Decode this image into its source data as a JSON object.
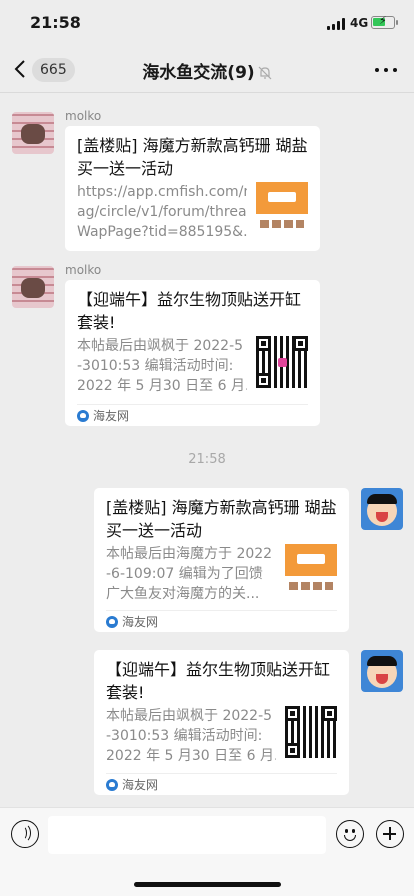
{
  "status_bar": {
    "time": "21:58",
    "network": "4G",
    "battery_level": 0.55,
    "battery_color": "#34c759"
  },
  "nav": {
    "back_icon": "chevron-left-icon",
    "unread_count": "665",
    "title": "海水鱼交流(9)",
    "mute_icon": "bell-slash-icon",
    "more_icon": "more-icon"
  },
  "messages": [
    {
      "sender": "molko",
      "title": "[盖楼贴] 海魔方新款高钙珊 瑚盐买一送一活动",
      "desc_lines": [
        "https://app.cmfish.com/m",
        "ag/circle/v1/forum/thread",
        "WapPage?tid=885195&..."
      ],
      "source": ""
    },
    {
      "sender": "molko",
      "title": "【迎端午】益尔生物顶贴送开缸套装!",
      "desc_lines": [
        "本帖最后由飒枫于 2022-5",
        "-3010:53 编辑活动时间:",
        "2022 年 5 月30 日至 6 月..."
      ],
      "source": "海友网"
    },
    {
      "sender": "",
      "title": "[盖楼贴] 海魔方新款高钙珊 瑚盐买一送一活动",
      "desc_lines": [
        "本帖最后由海魔方于 2022",
        "-6-109:07 编辑为了回馈",
        "广大鱼友对海魔方的关..."
      ],
      "source": "海友网"
    },
    {
      "sender": "",
      "title": "【迎端午】益尔生物顶贴送开缸套装!",
      "desc_lines": [
        "本帖最后由飒枫于 2022-5",
        "-3010:53 编辑活动时间:",
        "2022 年 5 月30 日至 6 月..."
      ],
      "source": "海友网"
    }
  ],
  "time_separator": "21:58",
  "input_bar": {
    "voice_icon": "voice-icon",
    "emoji_icon": "emoji-icon",
    "plus_icon": "plus-icon",
    "input_value": ""
  }
}
